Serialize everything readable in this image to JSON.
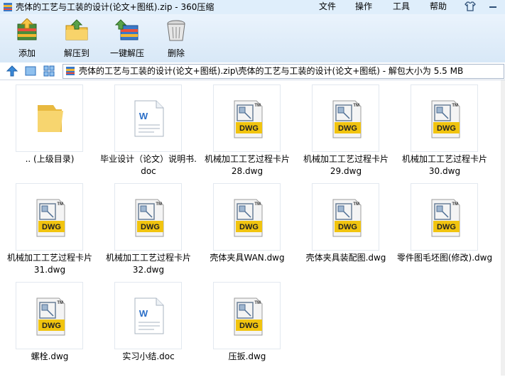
{
  "window": {
    "title": "壳体的工艺与工装的设计(论文+图纸).zip - 360压缩",
    "menus": [
      "文件",
      "操作",
      "工具",
      "帮助"
    ]
  },
  "toolbar": {
    "add_label": "添加",
    "extract_label": "解压到",
    "oneclick_label": "一键解压",
    "delete_label": "删除"
  },
  "address": {
    "path": "壳体的工艺与工装的设计(论文+图纸).zip\\壳体的工艺与工装的设计(论文+图纸) - 解包大小为 5.5 MB"
  },
  "files": [
    {
      "name": ".. (上级目录)",
      "type": "folder"
    },
    {
      "name": "毕业设计（论文）说明书.\ndoc",
      "type": "doc"
    },
    {
      "name": "机械加工工艺过程卡片\n28.dwg",
      "type": "dwg"
    },
    {
      "name": "机械加工工艺过程卡片\n29.dwg",
      "type": "dwg"
    },
    {
      "name": "机械加工工艺过程卡片\n30.dwg",
      "type": "dwg"
    },
    {
      "name": "机械加工工艺过程卡片\n31.dwg",
      "type": "dwg"
    },
    {
      "name": "机械加工工艺过程卡片\n32.dwg",
      "type": "dwg"
    },
    {
      "name": "壳体夹具WAN.dwg",
      "type": "dwg"
    },
    {
      "name": "壳体夹具装配图.dwg",
      "type": "dwg"
    },
    {
      "name": "零件图毛坯图(修改).dwg",
      "type": "dwg"
    },
    {
      "name": "螺栓.dwg",
      "type": "dwg"
    },
    {
      "name": "实习小结.doc",
      "type": "doc"
    },
    {
      "name": "压扳.dwg",
      "type": "dwg"
    }
  ],
  "dwg_icon_text": "DWG",
  "dwg_tm_text": "TM",
  "doc_icon_text": "W"
}
